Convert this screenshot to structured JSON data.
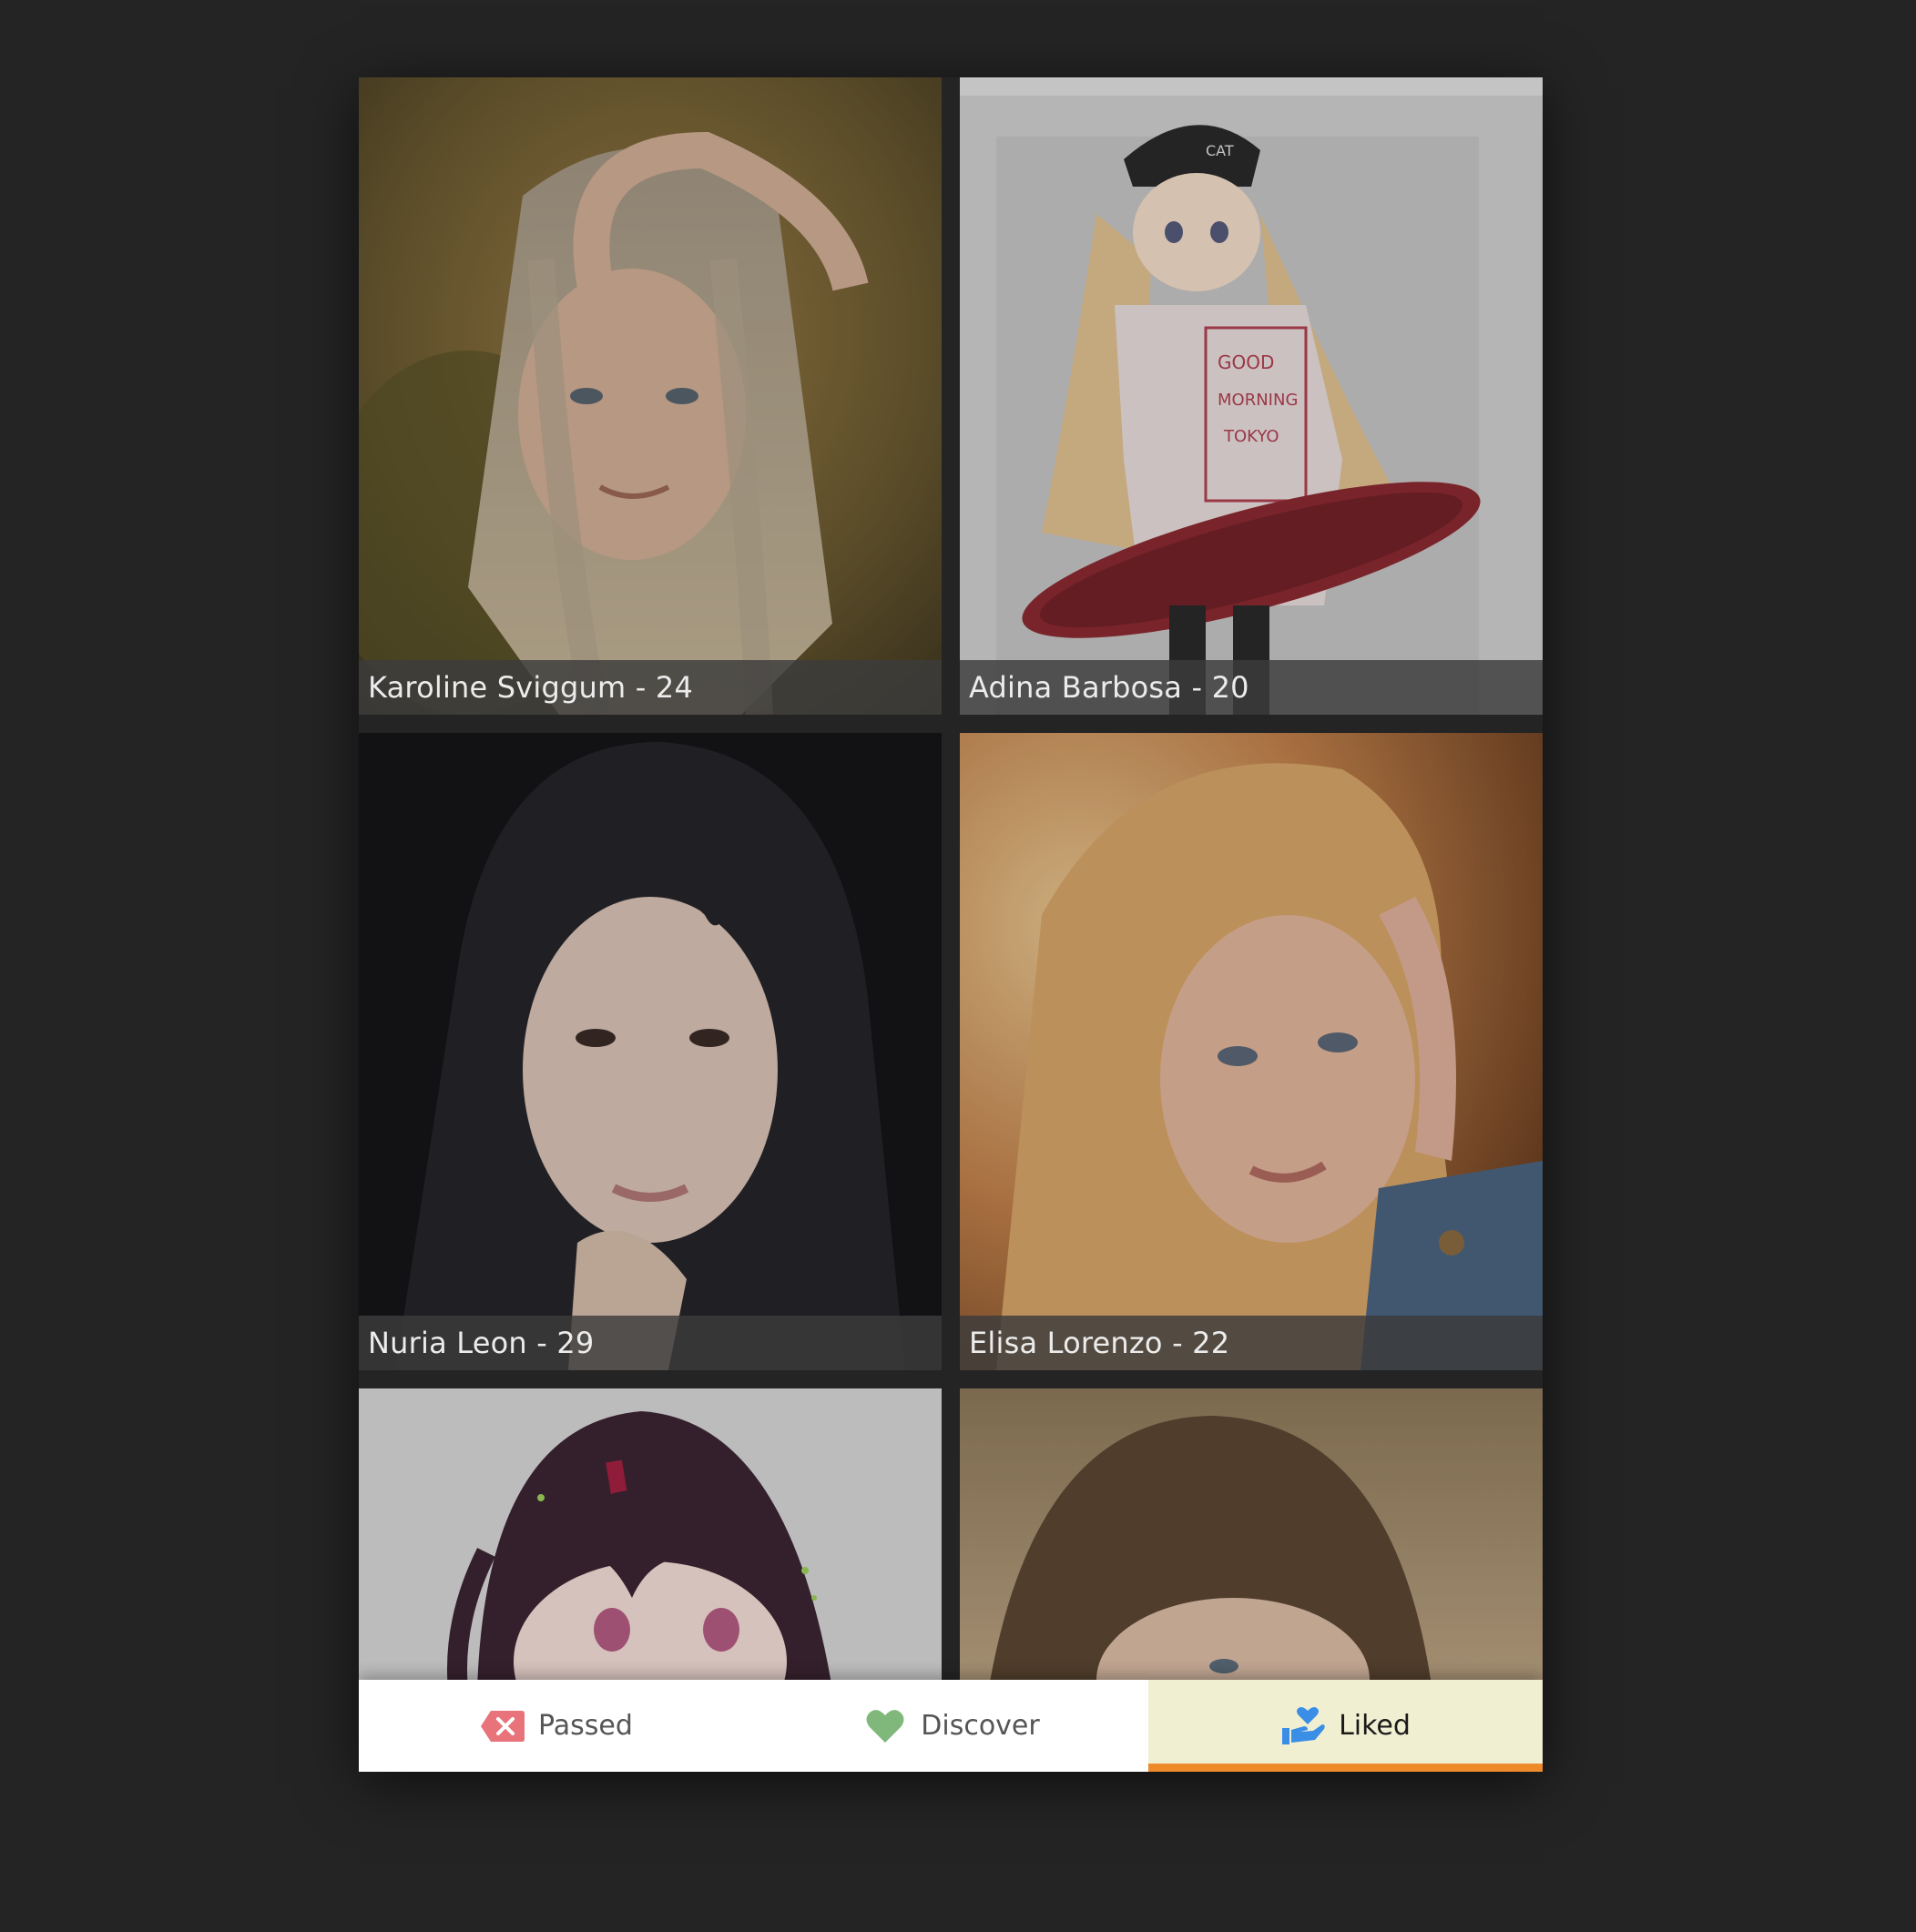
{
  "profiles": [
    {
      "name_age": "Karoline Sviggum - 24",
      "photo": "blonde-woman-photo"
    },
    {
      "name_age": "Adina Barbosa - 20",
      "photo": "anime-girl-cat-cap-skateboard-illustration"
    },
    {
      "name_age": "Nuria Leon - 29",
      "photo": "dark-haired-woman-photo"
    },
    {
      "name_age": "Elisa Lorenzo - 22",
      "photo": "strawberry-blonde-woman-photo"
    },
    {
      "name_age": "",
      "photo": "anime-girl-dark-red-hair-illustration"
    },
    {
      "name_age": "",
      "photo": "brown-haired-woman-photo"
    }
  ],
  "nav": {
    "tabs": [
      {
        "label": "Passed",
        "icon": "x-tag-icon",
        "color": "#e8737a"
      },
      {
        "label": "Discover",
        "icon": "heart-icon",
        "color": "#7fb87a"
      },
      {
        "label": "Liked",
        "icon": "hand-heart-icon",
        "color": "#3a8ee6",
        "active": true
      }
    ],
    "active_color": "#ee8a2a",
    "active_bg": "#f0efd2"
  },
  "colors": {
    "background": "#242424",
    "caption_bg": "#3c3c3c"
  }
}
